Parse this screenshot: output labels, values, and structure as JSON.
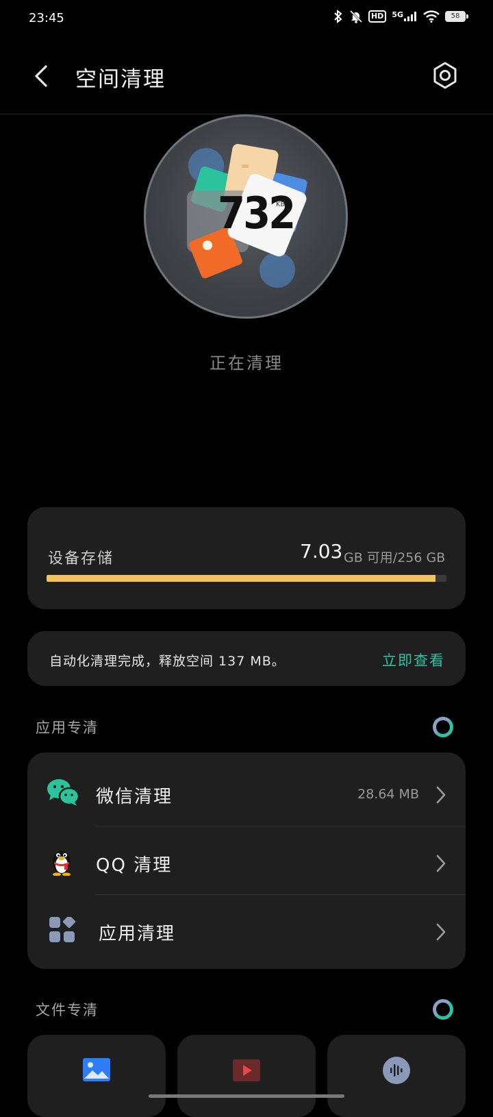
{
  "status_bar": {
    "time": "23:45",
    "network": "5G",
    "hd": "HD",
    "battery": "58",
    "icons": [
      "bluetooth-icon",
      "bell-muted-icon",
      "hd-icon",
      "signal-icon",
      "wifi-icon",
      "battery-icon"
    ]
  },
  "header": {
    "title": "空间清理",
    "back_icon": "chevron-left-icon",
    "settings_icon": "hexagon-settings-icon"
  },
  "cleaner": {
    "amount": "732",
    "unit": "KB",
    "status": "正在清理"
  },
  "storage": {
    "label": "设备存储",
    "free": "7.03",
    "total_text": "GB 可用/256 GB",
    "used_fraction": 0.973,
    "bar_color": "#f3c35c"
  },
  "auto_clean": {
    "message": "自动化清理完成，释放空间 137 MB。",
    "action": "立即查看",
    "accent_color": "#2bc3a3"
  },
  "app_section": {
    "title": "应用专清",
    "items": [
      {
        "label": "微信清理",
        "size": "28.64 MB",
        "icon": "wechat-icon"
      },
      {
        "label": "QQ 清理",
        "size": "",
        "icon": "qq-penguin-icon"
      },
      {
        "label": "应用清理",
        "size": "",
        "icon": "apps-grid-icon"
      }
    ]
  },
  "file_section": {
    "title": "文件专清",
    "items": [
      {
        "icon": "image-icon"
      },
      {
        "icon": "video-icon"
      },
      {
        "icon": "audio-icon"
      }
    ]
  }
}
